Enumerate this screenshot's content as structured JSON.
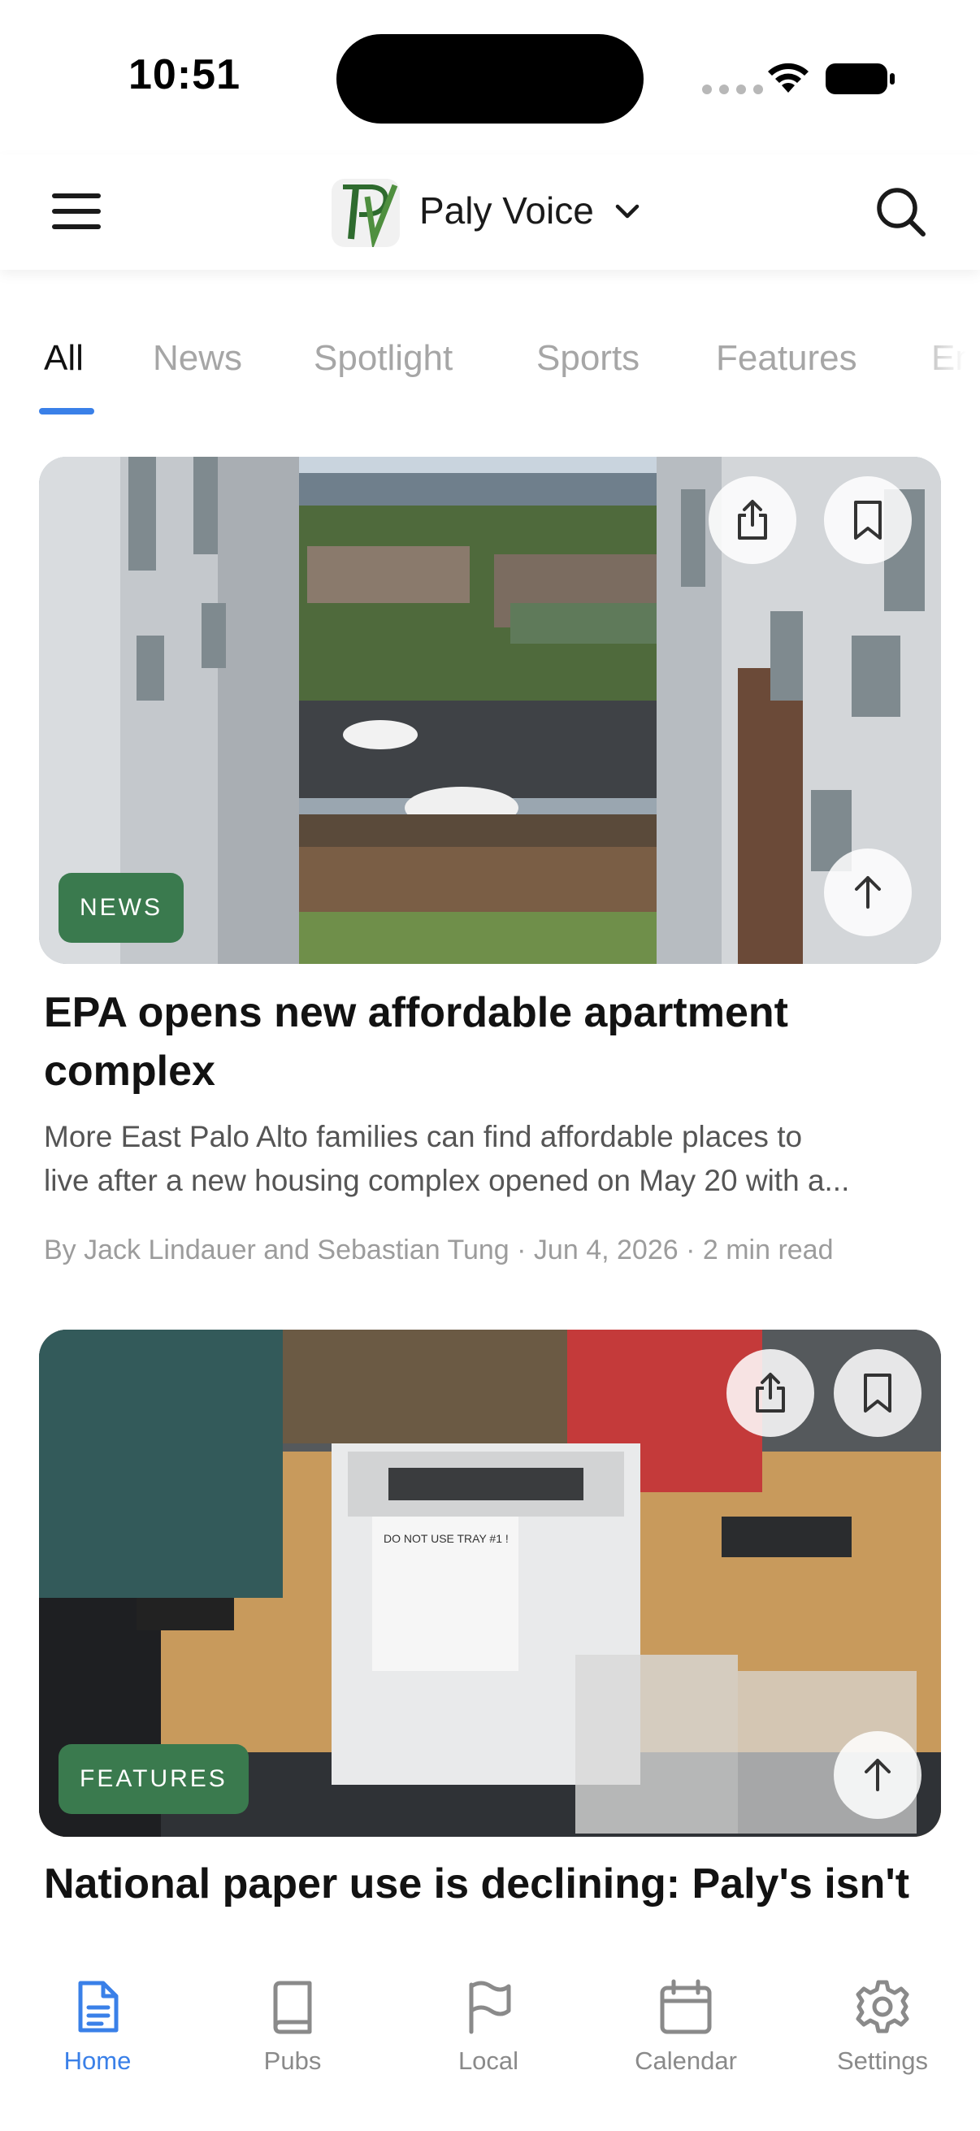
{
  "status_bar": {
    "time": "10:51"
  },
  "header": {
    "brand": "Paly Voice",
    "logo_letters": "PV",
    "icons": {
      "menu": "menu-icon",
      "dropdown": "chevron-down-icon",
      "search": "search-icon"
    }
  },
  "tabs": [
    {
      "label": "All",
      "active": true
    },
    {
      "label": "News",
      "active": false
    },
    {
      "label": "Spotlight",
      "active": false
    },
    {
      "label": "Sports",
      "active": false
    },
    {
      "label": "Features",
      "active": false
    },
    {
      "label": "En",
      "active": false
    }
  ],
  "articles": [
    {
      "category": "NEWS",
      "headline": "EPA opens new affordable apartment complex",
      "excerpt_line1": "More East Palo Alto families can find affordable places to",
      "excerpt_line2": "live after a new housing complex opened on May 20 with a...",
      "byline": "By Jack Lindauer and Sebastian Tung · Jun 4, 2026 · 2 min read",
      "image_subject": "courtyard-apartment-view"
    },
    {
      "category": "FEATURES",
      "headline": "National paper use is declining: Paly's isn't",
      "image_sign_line": "DO NOT USE TRAY #1 !",
      "image_subject": "printer-on-library-table"
    }
  ],
  "bottom_nav": [
    {
      "label": "Home",
      "icon": "document-icon",
      "active": true
    },
    {
      "label": "Pubs",
      "icon": "book-icon",
      "active": false
    },
    {
      "label": "Local",
      "icon": "flag-icon",
      "active": false
    },
    {
      "label": "Calendar",
      "icon": "calendar-icon",
      "active": false
    },
    {
      "label": "Settings",
      "icon": "gear-icon",
      "active": false
    }
  ],
  "colors": {
    "accent": "#3a80e8",
    "category_badge": "#3a7a4e",
    "inactive_text": "#a6a6a6"
  }
}
